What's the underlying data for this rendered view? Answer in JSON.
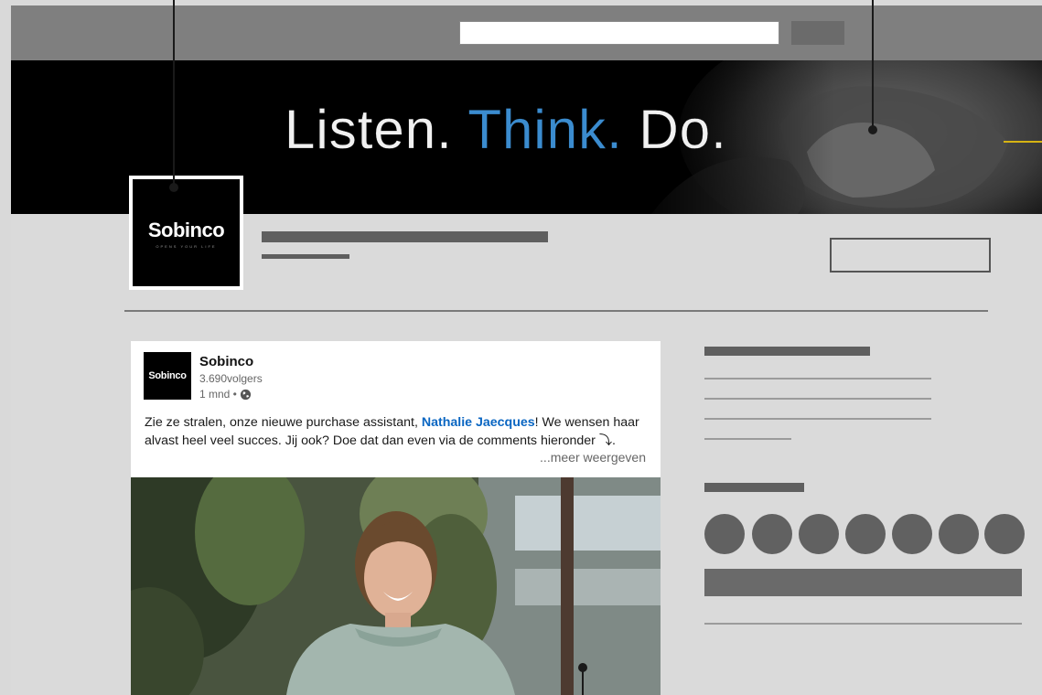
{
  "banner": {
    "slogan_part1": "Listen. ",
    "slogan_part2": "Think.",
    "slogan_part3": " Do."
  },
  "company": {
    "logo_word": "Sobinco",
    "logo_tagline": "OPENS YOUR LIFE"
  },
  "post": {
    "avatar_label": "Sobinco",
    "author": "Sobinco",
    "followers": "3.690volgers",
    "time": "1 mnd •",
    "visibility_icon": "globe-icon",
    "text_before": "Zie ze stralen, onze nieuwe purchase assistant, ",
    "mention": "Nathalie Jaecques",
    "text_after": "! We wensen haar alvast heel veel succes. Jij ook? Doe dat dan even via de comments hieronder ⤵.",
    "see_more": "...meer weergeven",
    "image": "photo-of-smiling-woman"
  },
  "colors": {
    "accent": "#3b8ccf",
    "mention": "#0a66c2",
    "page_bg": "#d9d9d9",
    "topbar": "#7f7f7f",
    "banner": "#000000",
    "callout": "#d6b313"
  }
}
